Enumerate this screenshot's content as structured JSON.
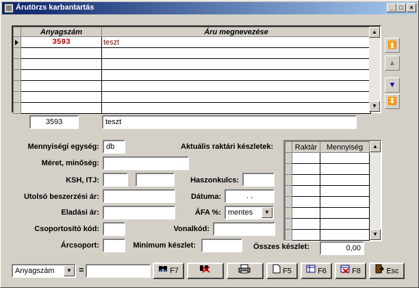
{
  "window": {
    "title": "Árutörzs karbantartás",
    "min": "_",
    "max": "□",
    "close": "×"
  },
  "grid": {
    "columns": [
      "Anyagszám",
      "Áru megnevezése"
    ],
    "rows": [
      {
        "code": "3593",
        "name": "teszt"
      }
    ]
  },
  "current": {
    "code": "3593",
    "name": "teszt"
  },
  "form": {
    "unit_label": "Mennyiségi egység:",
    "unit_value": "db",
    "size_label": "Méret, minőség:",
    "size_value": "",
    "ksh_label": "KSH, ITJ:",
    "ksh_value": "",
    "itj_value": "",
    "margin_label": "Haszonkulcs:",
    "margin_value": "",
    "lastbuy_label": "Utolsó beszerzési ár:",
    "lastbuy_value": "",
    "date_label": "Dátuma:",
    "date_value": ". .",
    "sale_label": "Eladási ár:",
    "sale_value": "",
    "vat_label": "ÁFA %:",
    "vat_value": "mentes",
    "group_label": "Csoportosító kód:",
    "group_value": "",
    "barcode_label": "Vonalkód:",
    "barcode_value": "",
    "pricegroup_label": "Árcsoport:",
    "pricegroup_value": "",
    "minstock_label": "Minimum készlet:",
    "minstock_value": ""
  },
  "stock": {
    "title": "Aktuális raktári készletek:",
    "columns": [
      "Raktár",
      "Mennyiség"
    ],
    "total_label": "Összes készlet:",
    "total_value": "0,00"
  },
  "bottom": {
    "search_field": "Anyagszám",
    "equals": "=",
    "search_value": "",
    "btn_f7": "F7",
    "btn_f5": "F5",
    "btn_f6": "F6",
    "btn_f8": "F8",
    "btn_esc": "Esc"
  },
  "colors": {
    "titlebar": "#0a246a",
    "code_text": "#c00000",
    "name_text": "#800000",
    "face": "#d4d0c8"
  }
}
